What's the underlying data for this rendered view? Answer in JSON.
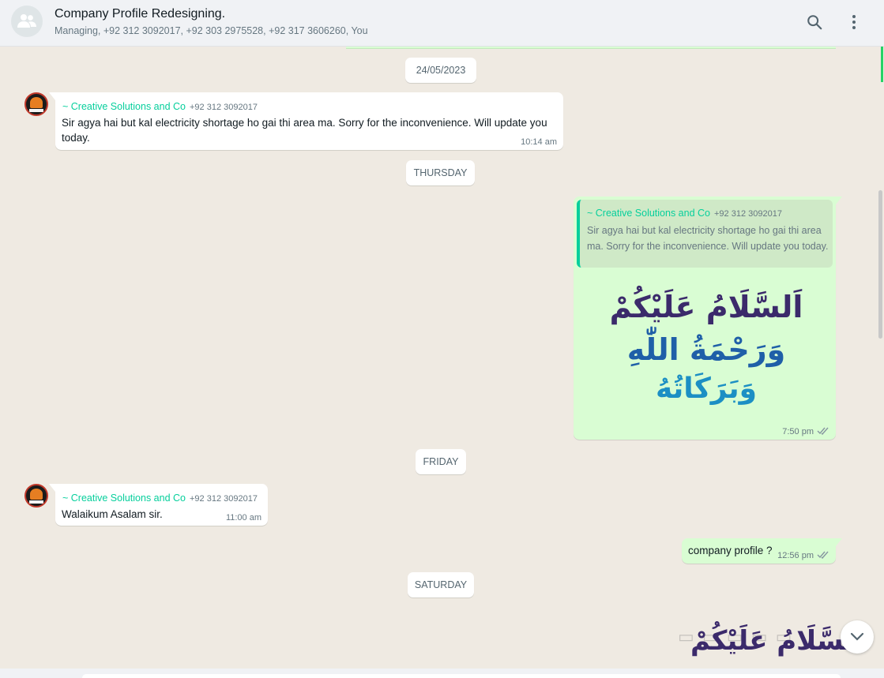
{
  "header": {
    "title": "Company Profile Redesigning.",
    "participants": "Managing, +92 312 3092017, +92 303 2975528, +92 317 3606260, You"
  },
  "dates": {
    "d1": "24/05/2023",
    "d2": "THURSDAY",
    "d3": "FRIDAY",
    "d4": "SATURDAY"
  },
  "messages": [
    {
      "direction": "incoming",
      "sender": "~ Creative Solutions and Co",
      "number": "+92 312 3092017",
      "text": "Sir agya hai but kal electricity shortage ho gai thi area ma. Sorry for the inconvenience. Will update you today.",
      "time": "10:14 am"
    },
    {
      "direction": "outgoing",
      "quote": {
        "sender": "~ Creative Solutions and Co",
        "number": "+92 312 3092017",
        "text": "Sir agya hai but kal electricity shortage ho gai thi area ma. Sorry for the inconvenience. Will update you today."
      },
      "image_text": {
        "line1": "اَلسَّلَامُ عَلَيْكُمْ",
        "line2": "وَرَحْمَةُ اللّٰهِ",
        "line3": "وَبَرَكَاتُهُ"
      },
      "time": "7:50 pm",
      "status": "read"
    },
    {
      "direction": "incoming",
      "sender": "~ Creative Solutions and Co",
      "number": "+92 312 3092017",
      "text": "Walaikum Asalam sir.",
      "time": "11:00 am"
    },
    {
      "direction": "outgoing",
      "text": "company profile ?",
      "time": "12:56 pm",
      "status": "read"
    }
  ],
  "partial_image_text": "اَلسَّلَامُ عَلَيْكُمْ",
  "icons": {
    "group_avatar": "group-icon",
    "search": "search-icon",
    "menu": "more-vert-icon",
    "scroll_down": "chevron-down-icon",
    "read_receipt": "double-check-icon"
  },
  "colors": {
    "incoming_bubble": "#ffffff",
    "outgoing_bubble": "#d9fdd3",
    "sender_name": "#06cf9c",
    "chat_background": "#efeae2",
    "header_background": "#f0f2f5"
  }
}
